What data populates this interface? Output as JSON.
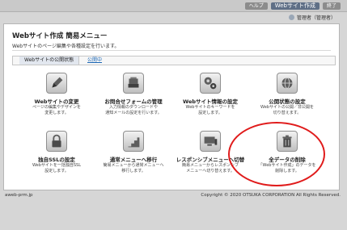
{
  "topbar": {
    "help": "ヘルプ",
    "product": "Webサイト作成",
    "close": "終了",
    "user_label": "管理者（管理者）"
  },
  "main": {
    "title": "Webサイト作成  簡易メニュー",
    "description": "Webサイトのページ編集や各種設定を行います。",
    "status": {
      "label": "Webサイトの公開状態",
      "value": "公開中"
    }
  },
  "tiles": [
    {
      "name": "site-change",
      "icon": "pen-icon",
      "label": "Webサイトの変更",
      "sub": [
        "ページの編集やデザインを",
        "変更します。"
      ]
    },
    {
      "name": "form-management",
      "icon": "mailbox-icon",
      "label": "お問合せフォームの管理",
      "sub": [
        "入力情報のダウンロードや",
        "通知メールの設定を行います。"
      ]
    },
    {
      "name": "site-settings",
      "icon": "gears-icon",
      "label": "Webサイト情報の設定",
      "sub": [
        "Webサイトのキーワードを",
        "設定します。"
      ]
    },
    {
      "name": "publish-settings",
      "icon": "globe-icon",
      "label": "公開状態の設定",
      "sub": [
        "Webサイトの公開／非公開を",
        "切り替えます。"
      ]
    },
    {
      "name": "ssl-settings",
      "icon": "lock-icon",
      "label": "独自SSLの設定",
      "sub": [
        "Webサイトを一括独自SSL",
        "設定します。"
      ]
    },
    {
      "name": "normal-menu",
      "icon": "stairs-icon",
      "label": "通常メニューへ移行",
      "sub": [
        "簡易メニューから通常メニューへ",
        "移行します。"
      ]
    },
    {
      "name": "responsive-menu",
      "icon": "devices-icon",
      "label": "レスポンシブメニューへ切替",
      "sub": [
        "簡易メニューからレスポンシブ",
        "メニューへ切り替えます。"
      ]
    },
    {
      "name": "delete-all-data",
      "icon": "trash-icon",
      "label": "全データの削除",
      "sub": [
        "「Webサイト作成」のデータを",
        "削除します。"
      ]
    }
  ],
  "footer": {
    "domain": "aweb-prm.jp",
    "copyright": "Copyright © 2020 OTSUKA CORPORATION All Rights Reserved."
  }
}
